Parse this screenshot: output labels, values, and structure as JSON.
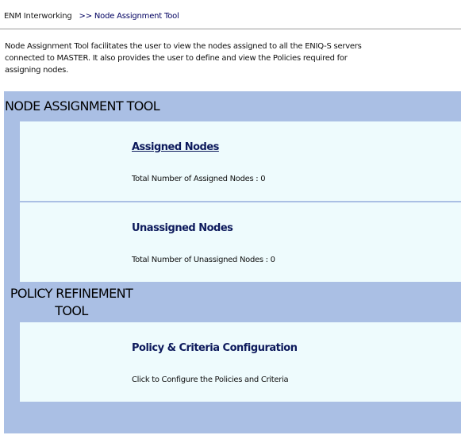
{
  "breadcrumb": {
    "root": "ENM Interworking",
    "separator": ">>",
    "current": "Node Assignment Tool"
  },
  "description": "Node Assignment Tool facilitates the user to view the nodes assigned to all the ENIQ-S servers connected to MASTER. It also provides the user to define and view the Policies required for assigning nodes.",
  "node_assignment": {
    "title": "NODE ASSIGNMENT TOOL",
    "assigned": {
      "title": "Assigned Nodes",
      "count_text": "Total Number of Assigned Nodes : 0"
    },
    "unassigned": {
      "title": "Unassigned Nodes",
      "count_text": "Total Number of Unassigned Nodes : 0"
    }
  },
  "policy_refinement": {
    "title_line1": "POLICY REFINEMENT",
    "title_line2": "TOOL",
    "config": {
      "title": "Policy & Criteria Configuration",
      "text": "Click to Configure the Policies and Criteria"
    }
  },
  "colors": {
    "panel_band": "#aabfe4",
    "card_background": "#eefbfd",
    "title_text": "#0d1a5c"
  }
}
